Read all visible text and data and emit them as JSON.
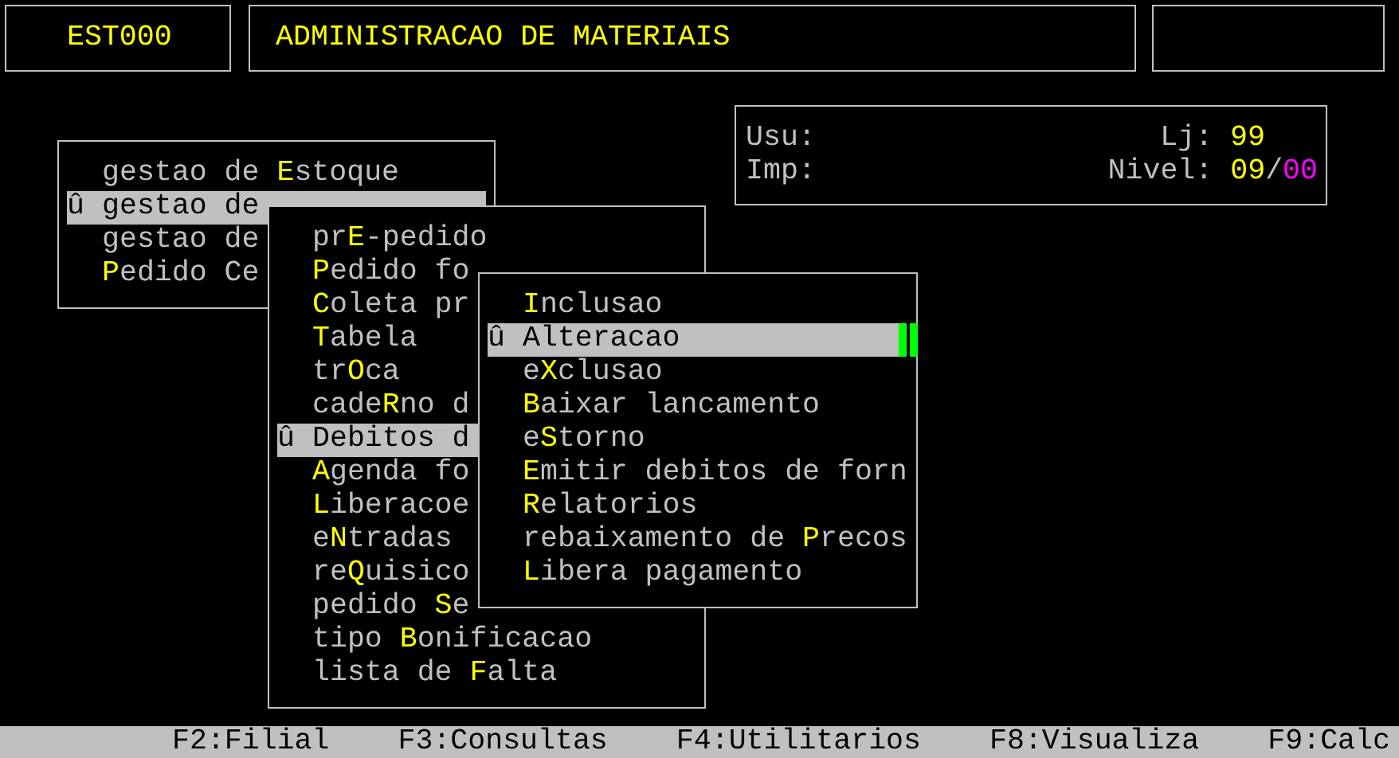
{
  "header": {
    "program_code": "EST000",
    "title": "ADMINISTRACAO DE MATERIAIS"
  },
  "info_panel": {
    "user_label": "Usu:",
    "printer_label": "Imp:",
    "store_label": "Lj:",
    "store": "99",
    "level_label": "Nivel:",
    "level_value": "09",
    "level_separator": "/",
    "level_max": "00"
  },
  "menus": [
    {
      "items": [
        {
          "before": "gestao de ",
          "hotkey": "E",
          "after": "stoque",
          "selected": false
        },
        {
          "marker": "û",
          "before": "gestao de",
          "selected": true
        },
        {
          "before": "gestao de",
          "selected": false
        },
        {
          "hotkey": "P",
          "after": "edido Ce",
          "selected": false
        }
      ]
    },
    {
      "items": [
        {
          "before": "pr",
          "hotkey": "E",
          "after": "-pedido",
          "selected": false
        },
        {
          "hotkey": "P",
          "after": "edido fo",
          "selected": false
        },
        {
          "hotkey": "C",
          "after": "oleta pr",
          "selected": false
        },
        {
          "hotkey": "T",
          "after": "abela",
          "selected": false
        },
        {
          "before": "tr",
          "hotkey": "O",
          "after": "ca",
          "selected": false
        },
        {
          "before": "cade",
          "hotkey": "R",
          "after": "no d",
          "selected": false
        },
        {
          "marker": "û",
          "hotkey": "D",
          "after": "ebitos d",
          "selected": true
        },
        {
          "hotkey": "A",
          "after": "genda fo",
          "selected": false
        },
        {
          "hotkey": "L",
          "after": "iberacoe",
          "selected": false
        },
        {
          "before": "e",
          "hotkey": "N",
          "after": "tradas",
          "selected": false
        },
        {
          "before": "re",
          "hotkey": "Q",
          "after": "uisico",
          "selected": false
        },
        {
          "before": "pedido ",
          "hotkey": "S",
          "after": "e",
          "selected": false
        },
        {
          "before": "tipo ",
          "hotkey": "B",
          "after": "onificacao",
          "selected": false
        },
        {
          "before": "lista de ",
          "hotkey": "F",
          "after": "alta",
          "selected": false
        }
      ]
    },
    {
      "items": [
        {
          "hotkey": "I",
          "after": "nclusao",
          "selected": false
        },
        {
          "marker": "û",
          "hotkey": "A",
          "after": "lteracao",
          "selected": true
        },
        {
          "before": "e",
          "hotkey": "X",
          "after": "clusao",
          "selected": false
        },
        {
          "hotkey": "B",
          "after": "aixar lancamento",
          "selected": false
        },
        {
          "before": "e",
          "hotkey": "S",
          "after": "torno",
          "selected": false
        },
        {
          "hotkey": "E",
          "after": "mitir debitos de forn",
          "selected": false
        },
        {
          "hotkey": "R",
          "after": "elatorios",
          "selected": false
        },
        {
          "before": "rebaixamento de ",
          "hotkey": "P",
          "after": "recos",
          "selected": false
        },
        {
          "hotkey": "L",
          "after": "ibera pagamento",
          "selected": false
        }
      ]
    }
  ],
  "function_keys": [
    "F2:Filial",
    "F3:Consultas",
    "F4:Utilitarios",
    "F8:Visualiza",
    "F9:Calc"
  ]
}
